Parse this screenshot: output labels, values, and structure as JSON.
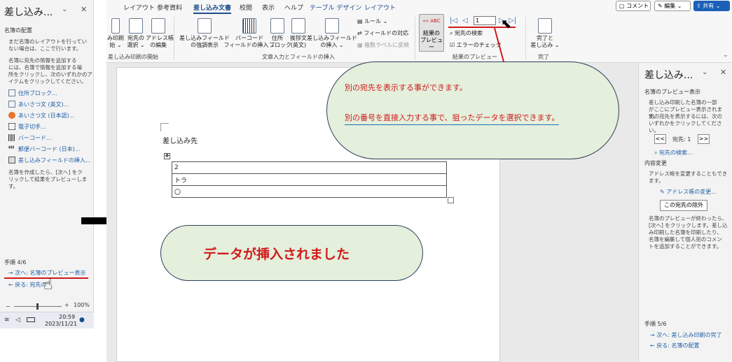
{
  "left_pane": {
    "title": "差し込み...",
    "section": "名簿の配置",
    "intro_1": "まだ名簿のレイアウトを行ってい",
    "intro_2": "ない場合は、ここで行います。",
    "desc_1": "名簿に宛先の情報を追加する",
    "desc_2": "には、名簿で情報を追加する場",
    "desc_3": "所をクリックし、次のいずれかのア",
    "desc_4": "イテムをクリックしてください。",
    "items": [
      "住所ブロック...",
      "あいさつ文 (英文)...",
      "あいさつ文 (日本語)...",
      "電子切手...",
      "バーコード...",
      "郵便バーコード (日本)...",
      "差し込みフィールドの挿入..."
    ],
    "after_1": "名簿を作成したら、[次へ] をク",
    "after_2": "リックして結果をプレビューしま",
    "after_3": "す。",
    "step": "手順 4/6",
    "next_link": "次へ: 名簿のプレビュー表示",
    "back_link": "戻る: 宛先の",
    "zoom": "100%"
  },
  "taskbar": {
    "time": "20:59",
    "date": "2023/11/21"
  },
  "ribbon": {
    "tabs": [
      "レイアウト",
      "参考資料",
      "差し込み文書",
      "校閲",
      "表示",
      "ヘルプ",
      "テーブル デザイン",
      "レイアウト"
    ],
    "comment": "コメント",
    "edit": "編集",
    "share": "共有",
    "buttons": {
      "print_a": "み印刷",
      "print_b": "始 ⌄",
      "select_a": "宛先の",
      "select_b": "選択 ⌄",
      "addr_a": "アドレス帳",
      "addr_b": "の編集",
      "highlight_a": "差し込みフィールド",
      "highlight_b": "の強調表示",
      "barcode_a": "バーコード",
      "barcode_b": "フィールドの挿入 ⌄",
      "addrblk_a": "住所",
      "addrblk_b": "ブロック",
      "greet_a": "挨拶文",
      "greet_b": "(英文)",
      "insert_a": "差し込みフィールド",
      "insert_b": "の挿入 ⌄",
      "rules": "ルール ⌄",
      "match": "フィールドの対応",
      "multi": "複数ラベルに反映",
      "preview_a": "結果の",
      "preview_b": "プレビュー",
      "find": "宛先の検索",
      "check": "エラーのチェック",
      "finish_a": "完了と",
      "finish_b": "差し込み ⌄",
      "record": "1"
    },
    "groups": [
      "差し込み印刷の開始",
      "文章入力とフィールドの挿入",
      "結果のプレビュー",
      "完了"
    ]
  },
  "document": {
    "heading": "差し込み先",
    "rows": [
      "2",
      "トラ",
      "〇"
    ]
  },
  "callout_top": {
    "line1": "別の宛先を表示する事ができます。",
    "line2": "別の番号を直接入力する事で、狙ったデータを選択できます。"
  },
  "callout_mid": {
    "text": "データが挿入されました"
  },
  "right_pane": {
    "title": "差し込み...",
    "section1": "名簿のプレビュー表示",
    "p1_1": "差し込み印刷した名簿の一部",
    "p1_2": "がここにプレビュー表示されます。",
    "p1_3": "別の宛先を表示するには、次の",
    "p1_4": "いずれかをクリックしてください。",
    "recipient": "宛先: 1",
    "find": "宛先の検索...",
    "section2": "内容変更",
    "p2": "アドレス帳を変更することもできます。",
    "addr_change": "アドレス帳の変更...",
    "exclude": "この宛先の除外",
    "p3_1": "名簿のプレビューが終わったら、",
    "p3_2": "[次へ] をクリックします。差し込",
    "p3_3": "み印刷した名簿を印刷したり、",
    "p3_4": "名簿を編集して個人宛のコメン",
    "p3_5": "トを追加することができます。",
    "step": "手順 5/6",
    "next_link": "次へ: 差し込み印刷の完了",
    "back_link": "戻る: 名簿の配置"
  },
  "colors": {
    "accent": "#1b4c8c",
    "callout_fill": "#e4efdc",
    "callout_text": "#d11a1a",
    "underline": "#d11a1a"
  }
}
